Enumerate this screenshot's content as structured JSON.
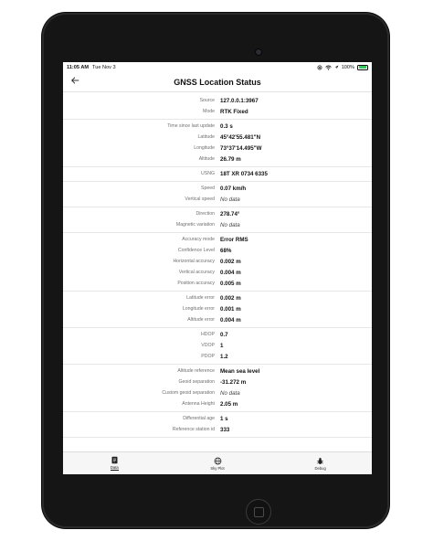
{
  "status_bar": {
    "time": "11:05 AM",
    "date": "Tue Nov 3",
    "battery": "100%",
    "battery_level": 1.0,
    "battery_color": "#34c759"
  },
  "nav": {
    "title": "GNSS Location Status",
    "back_icon": "arrow-left-icon"
  },
  "groups": [
    [
      {
        "label": "Source",
        "value": "127.0.0.1:3967"
      },
      {
        "label": "Mode",
        "value": "RTK Fixed"
      }
    ],
    [
      {
        "label": "Time since last update",
        "value": "0.3 s"
      },
      {
        "label": "Latitude",
        "value": "45°42'55.481\"N"
      },
      {
        "label": "Longitude",
        "value": "73°37'14.495\"W"
      },
      {
        "label": "Altitude",
        "value": "26.79 m"
      }
    ],
    [
      {
        "label": "USNG",
        "value": "18T XR 0734 6335"
      }
    ],
    [
      {
        "label": "Speed",
        "value": "0.07 km/h"
      },
      {
        "label": "Vertical speed",
        "value": "No data",
        "nodata": true
      }
    ],
    [
      {
        "label": "Direction",
        "value": "278.74°"
      },
      {
        "label": "Magnetic variation",
        "value": "No data",
        "nodata": true
      }
    ],
    [
      {
        "label": "Accuracy mode",
        "value": "Error RMS"
      },
      {
        "label": "Confidence Level",
        "value": "68%"
      },
      {
        "label": "Horizontal accuracy",
        "value": "0.002 m"
      },
      {
        "label": "Vertical accuracy",
        "value": "0.004 m"
      },
      {
        "label": "Position accuracy",
        "value": "0.005 m"
      }
    ],
    [
      {
        "label": "Latitude error",
        "value": "0.002 m"
      },
      {
        "label": "Longitude error",
        "value": "0.001 m"
      },
      {
        "label": "Altitude error",
        "value": "0.004 m"
      }
    ],
    [
      {
        "label": "HDOP",
        "value": "0.7"
      },
      {
        "label": "VDOP",
        "value": "1"
      },
      {
        "label": "PDOP",
        "value": "1.2"
      }
    ],
    [
      {
        "label": "Altitude reference",
        "value": "Mean sea level"
      },
      {
        "label": "Geoid separation",
        "value": "-31.272 m"
      },
      {
        "label": "Custom geoid separation",
        "value": "No data",
        "nodata": true
      },
      {
        "label": "Antenna Height",
        "value": "2.05 m"
      }
    ],
    [
      {
        "label": "Differential age",
        "value": "1 s"
      },
      {
        "label": "Reference station id",
        "value": "333"
      }
    ]
  ],
  "tabs": [
    {
      "label": "Data",
      "icon": "document-icon",
      "active": true
    },
    {
      "label": "Sky Plot",
      "icon": "globe-icon",
      "active": false
    },
    {
      "label": "Debug",
      "icon": "bug-icon",
      "active": false
    }
  ]
}
